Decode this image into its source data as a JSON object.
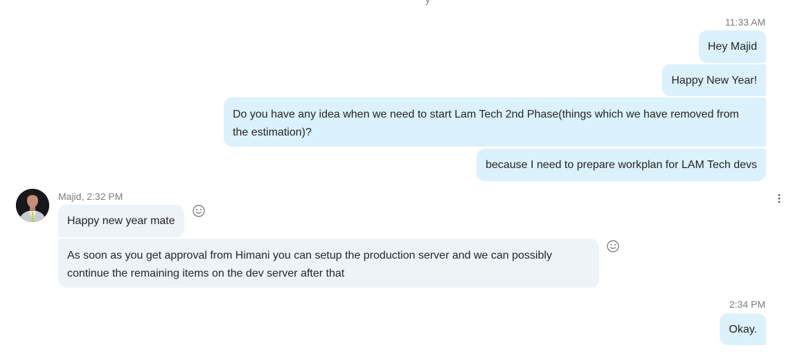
{
  "chat": {
    "messages": [
      {
        "time": "11:33 AM"
      },
      {
        "text": "Hey Majid"
      },
      {
        "text": "Happy New Year!"
      },
      {
        "text": "Do you have any idea when we need to start Lam Tech 2nd Phase(things which we have removed from the estimation)?"
      },
      {
        "text": "because I need to prepare workplan for LAM Tech devs"
      },
      {
        "sender_line": "Majid, 2:32 PM"
      },
      {
        "text": "Happy new year mate"
      },
      {
        "text": "As soon as you get approval from Himani you can setup the production server and we can possibly continue the remaining items on the dev server after that"
      },
      {
        "time": "2:34 PM"
      },
      {
        "text": "Okay."
      }
    ],
    "icons": {
      "reaction": "smiley-reaction-icon",
      "more": "more-options-icon",
      "avatar": "avatar"
    },
    "colors": {
      "outgoing_bubble": "#dbf1fb",
      "incoming_bubble": "#eef3f7",
      "meta_text": "#7a7a7a",
      "message_text": "#252525"
    }
  }
}
